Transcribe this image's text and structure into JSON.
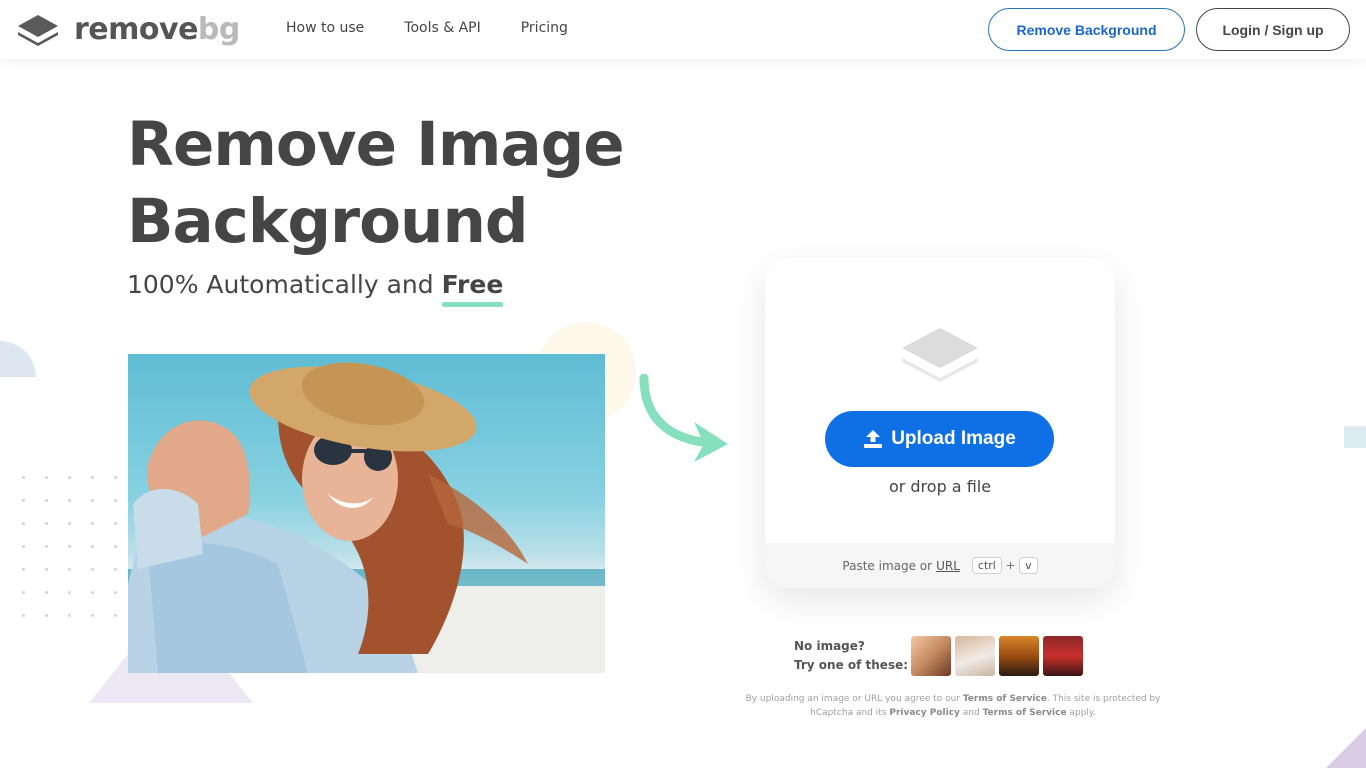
{
  "header": {
    "logo_remove": "remove",
    "logo_bg": "bg",
    "nav": [
      {
        "label": "How to use"
      },
      {
        "label": "Tools & API"
      },
      {
        "label": "Pricing"
      }
    ],
    "remove_bg_button": "Remove Background",
    "login_button": "Login / Sign up"
  },
  "hero": {
    "title_line1": "Remove Image",
    "title_line2": "Background",
    "subtitle_prefix": "100% Automatically and",
    "subtitle_free": "Free"
  },
  "upload": {
    "button_label": "Upload Image",
    "drop_text": "or drop a file",
    "paste_prefix": "Paste image or",
    "paste_url": "URL",
    "key_ctrl": "ctrl",
    "key_plus": "+",
    "key_v": "v"
  },
  "samples": {
    "line1": "No image?",
    "line2": "Try one of these:"
  },
  "terms": {
    "part1": "By uploading an image or URL you agree to our",
    "tos1": "Terms of Service",
    "part2": ". This site is protected by hCaptcha and its",
    "privacy": "Privacy Policy",
    "part3": "and",
    "tos2": "Terms of Service",
    "part4": "apply."
  },
  "colors": {
    "primary_blue": "#0f70e6",
    "accent_green": "#86e0c0",
    "text_dark": "#454545"
  }
}
